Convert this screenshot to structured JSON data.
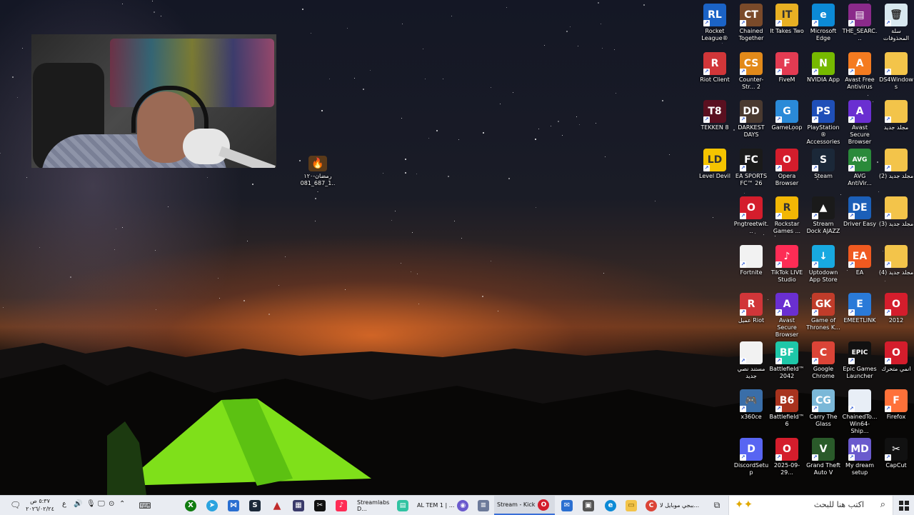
{
  "desktop": {
    "loose_file": {
      "label": "رمضان-١٢٠ 1_687_081...",
      "icon": "image-file-icon"
    },
    "columns": [
      [
        {
          "label": "Rocket League®",
          "icon": "rocket-league-icon",
          "color": "#1b63c6",
          "glyph": "RL"
        },
        {
          "label": "Riot Client",
          "icon": "riot-client-icon",
          "color": "#d13639",
          "glyph": "R"
        },
        {
          "label": "TEKKEN 8",
          "icon": "tekken-icon",
          "color": "#5a1020",
          "glyph": "T8"
        },
        {
          "label": "Level Devil",
          "icon": "level-devil-icon",
          "color": "#f5c400",
          "glyph": "LD"
        }
      ],
      [
        {
          "label": "Chained Together",
          "icon": "chained-together-icon",
          "color": "#7a4a2a",
          "glyph": "CT"
        },
        {
          "label": "Counter-Str... 2",
          "icon": "counter-strike-icon",
          "color": "#e28a1a",
          "glyph": "CS"
        },
        {
          "label": "DARKEST DAYS",
          "icon": "darkest-days-icon",
          "color": "#4a3a30",
          "glyph": "DD"
        },
        {
          "label": "EA SPORTS FC™ 26",
          "icon": "ea-sports-fc-icon",
          "color": "#1a1a1a",
          "glyph": "FC"
        },
        {
          "label": "Pngtreetwit...",
          "icon": "opera-icon",
          "color": "#d41d2c",
          "glyph": "O"
        },
        {
          "label": "Fortnite",
          "icon": "file-icon",
          "color": "#f2f2f2",
          "glyph": ""
        },
        {
          "label": "عميل Riot",
          "icon": "riot-client-icon",
          "color": "#d13639",
          "glyph": "R"
        },
        {
          "label": "مستند نصي جديد",
          "icon": "text-document-icon",
          "color": "#f2f2f2",
          "glyph": ""
        },
        {
          "label": "x360ce",
          "icon": "gamepad-icon",
          "color": "#3a6ea8",
          "glyph": "🎮"
        },
        {
          "label": "DiscordSetup",
          "icon": "discord-icon",
          "color": "#5865f2",
          "glyph": "D"
        }
      ],
      [
        {
          "label": "It Takes Two",
          "icon": "it-takes-two-icon",
          "color": "#e8b023",
          "glyph": "IT"
        },
        {
          "label": "FiveM",
          "icon": "fivem-icon",
          "color": "#e33b52",
          "glyph": "F"
        },
        {
          "label": "GameLoop",
          "icon": "gameloop-icon",
          "color": "#2a8ad8",
          "glyph": "G"
        },
        {
          "label": "Opera Browser",
          "icon": "opera-icon",
          "color": "#d41d2c",
          "glyph": "O"
        },
        {
          "label": "Rockstar Games ...",
          "icon": "rockstar-icon",
          "color": "#f2b705",
          "glyph": "R"
        },
        {
          "label": "TikTok LIVE Studio",
          "icon": "tiktok-icon",
          "color": "#fe2c55",
          "glyph": "♪"
        },
        {
          "label": "Avast Secure Browser",
          "icon": "avast-browser-icon",
          "color": "#6a2fd1",
          "glyph": "A"
        },
        {
          "label": "Battlefield™ 2042",
          "icon": "battlefield-2042-icon",
          "color": "#1ec7a8",
          "glyph": "BF"
        },
        {
          "label": "Battlefield™ 6",
          "icon": "battlefield-6-icon",
          "color": "#a8331e",
          "glyph": "B6"
        },
        {
          "label": "2025-09-29...",
          "icon": "opera-icon",
          "color": "#d41d2c",
          "glyph": "O"
        }
      ],
      [
        {
          "label": "Microsoft Edge",
          "icon": "edge-icon",
          "color": "#0c8ad6",
          "glyph": "e"
        },
        {
          "label": "NVIDIA App",
          "icon": "nvidia-icon",
          "color": "#76b900",
          "glyph": "N"
        },
        {
          "label": "PlayStation® Accessories",
          "icon": "playstation-icon",
          "color": "#1f4fb8",
          "glyph": "PS"
        },
        {
          "label": "Steam",
          "icon": "steam-icon",
          "color": "#1b2838",
          "glyph": "S"
        },
        {
          "label": "Stream Dock AJAZZ",
          "icon": "stream-dock-icon",
          "color": "#1a1a1a",
          "glyph": "▲"
        },
        {
          "label": "Uptodown App Store",
          "icon": "uptodown-icon",
          "color": "#18a9e0",
          "glyph": "↓"
        },
        {
          "label": "Game of Thrones K...",
          "icon": "game-of-thrones-icon",
          "color": "#c03c2a",
          "glyph": "GK"
        },
        {
          "label": "Google Chrome",
          "icon": "chrome-icon",
          "color": "#db4437",
          "glyph": "C"
        },
        {
          "label": "Carry The Glass",
          "icon": "carry-the-glass-icon",
          "color": "#7bb8d8",
          "glyph": "CG"
        },
        {
          "label": "Grand Theft Auto V",
          "icon": "gta-icon",
          "color": "#2a5a2a",
          "glyph": "V"
        }
      ],
      [
        {
          "label": "THE_SEARC...",
          "icon": "winrar-icon",
          "color": "#8a2a8a",
          "glyph": "▤"
        },
        {
          "label": "Avast Free Antivirus",
          "icon": "avast-icon",
          "color": "#f47b20",
          "glyph": "A"
        },
        {
          "label": "Avast Secure Browser",
          "icon": "avast-browser-icon",
          "color": "#6a2fd1",
          "glyph": "A"
        },
        {
          "label": "AVG AntiVir...",
          "icon": "avg-icon",
          "color": "#2a8a3a",
          "glyph": "AVG"
        },
        {
          "label": "Driver Easy",
          "icon": "driver-easy-icon",
          "color": "#1b5fb8",
          "glyph": "DE"
        },
        {
          "label": "EA",
          "icon": "ea-icon",
          "color": "#f05a20",
          "glyph": "EA"
        },
        {
          "label": "EMEETLINK",
          "icon": "emeetlink-icon",
          "color": "#2a7ad8",
          "glyph": "E"
        },
        {
          "label": "Epic Games Launcher",
          "icon": "epic-games-icon",
          "color": "#111",
          "glyph": "EPIC"
        },
        {
          "label": "ChainedTo... Win64-Ship...",
          "icon": "exe-icon",
          "color": "#e8eef6",
          "glyph": ""
        },
        {
          "label": "My dream setup",
          "icon": "my-dream-setup-icon",
          "color": "#6a5acd",
          "glyph": "MD"
        }
      ],
      [
        {
          "label": "سلة المحذوفات",
          "icon": "recycle-bin-icon",
          "color": "#d8e8f0",
          "glyph": "🗑"
        },
        {
          "label": "DS4Windows",
          "icon": "folder-icon",
          "color": "#f3c44a",
          "glyph": ""
        },
        {
          "label": "مجلد جديد",
          "icon": "folder-icon",
          "color": "#f3c44a",
          "glyph": ""
        },
        {
          "label": "مجلد جديد (2)",
          "icon": "folder-icon",
          "color": "#f3c44a",
          "glyph": ""
        },
        {
          "label": "مجلد جديد (3)",
          "icon": "folder-icon",
          "color": "#f3c44a",
          "glyph": ""
        },
        {
          "label": "مجلد جديد (4)",
          "icon": "folder-icon",
          "color": "#f3c44a",
          "glyph": ""
        },
        {
          "label": "2012",
          "icon": "opera-icon",
          "color": "#d41d2c",
          "glyph": "O"
        },
        {
          "label": "انمي متحرك",
          "icon": "opera-icon",
          "color": "#d41d2c",
          "glyph": "O"
        },
        {
          "label": "Firefox",
          "icon": "firefox-icon",
          "color": "#ff7139",
          "glyph": "F"
        },
        {
          "label": "CapCut",
          "icon": "capcut-icon",
          "color": "#111",
          "glyph": "✂"
        }
      ]
    ]
  },
  "taskbar": {
    "search_placeholder": "اكتب هنا للبحث",
    "clock_time": "٥:٣٧ ص",
    "clock_date": "٢٠٢٦/٠٢/٢٤",
    "lang": "ع",
    "apps": [
      {
        "label": "ببجي موبايل لا...",
        "icon": "chrome-icon",
        "color": "#db4437",
        "active": false
      },
      {
        "label": "Stream - Kick",
        "icon": "opera-icon",
        "color": "#d41d2c",
        "active": true
      },
      {
        "label": "AL TEM 1 | ...",
        "icon": "app-icon",
        "color": "#6a5acd",
        "active": false
      },
      {
        "label": "Streamlabs D...",
        "icon": "streamlabs-icon",
        "color": "#31c3a2",
        "active": false
      }
    ]
  }
}
